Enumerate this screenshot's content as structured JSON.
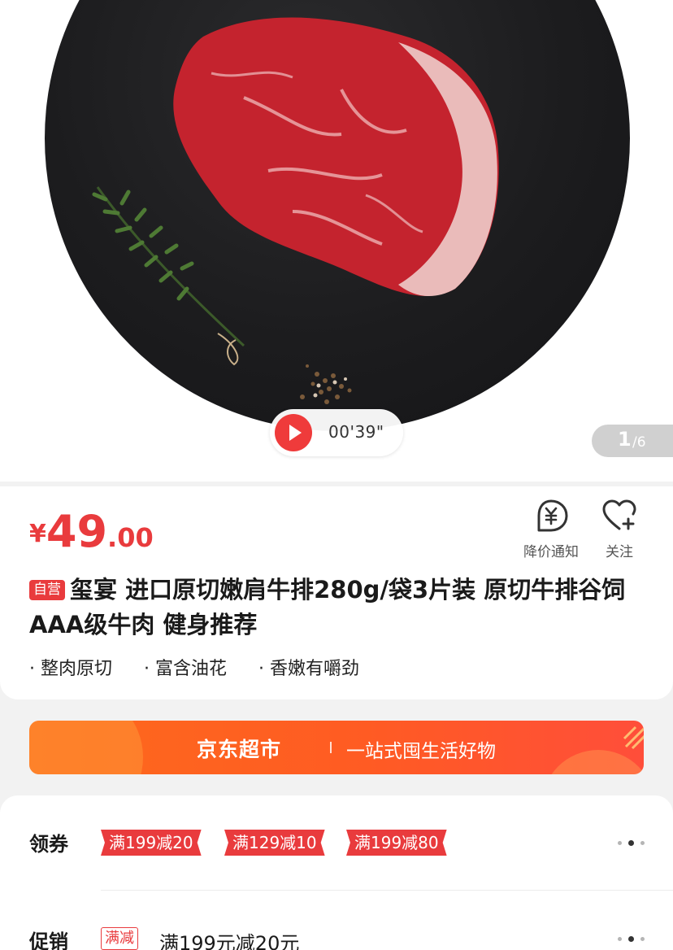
{
  "media": {
    "video_duration": "00'39\"",
    "current_image": "1",
    "total_images": "/6"
  },
  "product": {
    "price_symbol": "¥",
    "price_integer": "49",
    "price_decimal": ".00",
    "self_operated_tag": "自营",
    "title": "玺宴 进口原切嫩肩牛排280g/袋3片装 原切牛排谷饲AAA级牛肉 健身推荐",
    "features": [
      "整肉原切",
      "富含油花",
      "香嫩有嚼劲"
    ]
  },
  "actions": {
    "price_alert_label": "降价通知",
    "follow_label": "关注"
  },
  "banner": {
    "brand": "京东超市",
    "slogan": "一站式囤生活好物"
  },
  "coupons": {
    "label": "领券",
    "items": [
      "满199减20",
      "满129减10",
      "满199减80"
    ]
  },
  "promotion": {
    "label": "促销",
    "tag": "满减",
    "text": "满199元减20元"
  },
  "colors": {
    "accent_red": "#e93b3d",
    "banner_orange": "#ff5b23"
  }
}
